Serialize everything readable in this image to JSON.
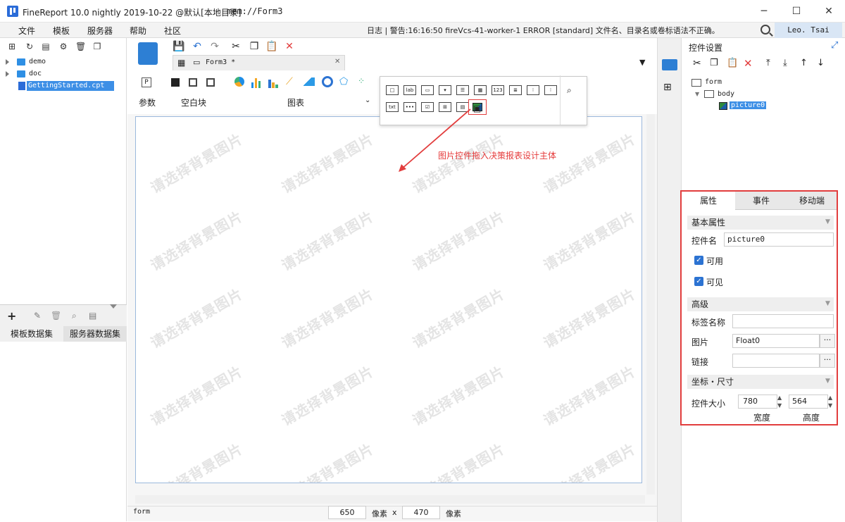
{
  "window": {
    "title": "FineReport 10.0 nightly 2019-10-22 @默认[本地目录]",
    "path": "mem://Form3",
    "minimize": "─",
    "maximize": "☐",
    "close": "✕"
  },
  "menu": [
    "文件",
    "模板",
    "服务器",
    "帮助",
    "社区"
  ],
  "log_message": "日志 | 警告:16:16:50 fireVcs-41-worker-1 ERROR [standard] 文件名、目录名或卷标语法不正确。",
  "user": "Leo. Tsai",
  "left_tree": [
    {
      "label": "demo",
      "type": "folder"
    },
    {
      "label": "doc",
      "type": "folder"
    },
    {
      "label": "GettingStarted.cpt",
      "type": "file",
      "selected": true
    }
  ],
  "dataset_tabs": [
    "模板数据集",
    "服务器数据集"
  ],
  "editor_tab": "Form3 *",
  "toolbar_groups": {
    "param": "参数",
    "blank": "空白块",
    "chart": "图表"
  },
  "popup_widgets": [
    "□",
    "lab",
    "▭",
    "▾",
    "☰",
    "▦",
    "123",
    "≣",
    "⁝",
    "⁝",
    "txt",
    "•••",
    "☑",
    "⊞",
    "▤",
    "▣"
  ],
  "callout": "图片控件拖入决策报表设计主体",
  "watermark": "请选择背景图片",
  "status": {
    "label": "form",
    "width_value": "650",
    "unit1": "像素",
    "times": "x",
    "height_value": "470",
    "unit2": "像素"
  },
  "right_panel": {
    "title": "控件设置",
    "tree": [
      "form",
      "body",
      "picture0"
    ]
  },
  "props": {
    "tabs": [
      "属性",
      "事件",
      "移动端"
    ],
    "basic_section": "基本属性",
    "name_label": "控件名",
    "name_value": "picture0",
    "enabled_label": "可用",
    "visible_label": "可见",
    "advanced_section": "高级",
    "tag_label": "标签名称",
    "tag_value": "",
    "image_label": "图片",
    "image_value": "Float0",
    "link_label": "链接",
    "link_value": "",
    "ellipsis": "···",
    "coord_section": "坐标・尺寸",
    "size_label": "控件大小",
    "width": "780",
    "height": "564",
    "width_caption": "宽度",
    "height_caption": "高度"
  },
  "colors": {
    "accent": "#2c73d2",
    "highlight": "#e23d3d",
    "selection": "#3d8fe6"
  }
}
